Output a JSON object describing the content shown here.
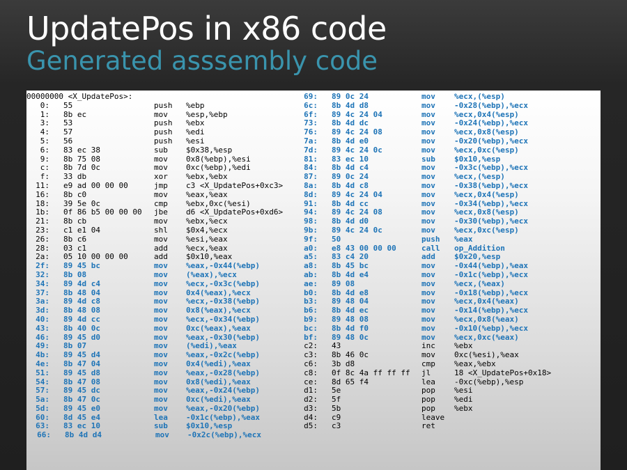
{
  "title": "UpdatePos in x86 code",
  "subtitle": "Generated asssembly code",
  "colors": {
    "highlight": "#1e74b7",
    "subtitle": "#3a94ad"
  },
  "left_header": "00000000 <X_UpdatePos>:",
  "left": [
    {
      "a": "0:",
      "b": "55",
      "c": "push",
      "d": "%ebp",
      "hl": false
    },
    {
      "a": "1:",
      "b": "8b ec",
      "c": "mov",
      "d": "%esp,%ebp",
      "hl": false
    },
    {
      "a": "3:",
      "b": "53",
      "c": "push",
      "d": "%ebx",
      "hl": false
    },
    {
      "a": "4:",
      "b": "57",
      "c": "push",
      "d": "%edi",
      "hl": false
    },
    {
      "a": "5:",
      "b": "56",
      "c": "push",
      "d": "%esi",
      "hl": false
    },
    {
      "a": "6:",
      "b": "83 ec 38",
      "c": "sub",
      "d": "$0x38,%esp",
      "hl": false
    },
    {
      "a": "9:",
      "b": "8b 75 08",
      "c": "mov",
      "d": "0x8(%ebp),%esi",
      "hl": false
    },
    {
      "a": "c:",
      "b": "8b 7d 0c",
      "c": "mov",
      "d": "0xc(%ebp),%edi",
      "hl": false
    },
    {
      "a": "f:",
      "b": "33 db",
      "c": "xor",
      "d": "%ebx,%ebx",
      "hl": false
    },
    {
      "a": "11:",
      "b": "e9 ad 00 00 00",
      "c": "jmp",
      "d": "c3 <X_UpdatePos+0xc3>",
      "hl": false
    },
    {
      "a": "16:",
      "b": "8b c0",
      "c": "mov",
      "d": "%eax,%eax",
      "hl": false
    },
    {
      "a": "18:",
      "b": "39 5e 0c",
      "c": "cmp",
      "d": "%ebx,0xc(%esi)",
      "hl": false
    },
    {
      "a": "1b:",
      "b": "0f 86 b5 00 00 00",
      "c": "jbe",
      "d": "d6 <X_UpdatePos+0xd6>",
      "hl": false
    },
    {
      "a": "21:",
      "b": "8b cb",
      "c": "mov",
      "d": "%ebx,%ecx",
      "hl": false
    },
    {
      "a": "23:",
      "b": "c1 e1 04",
      "c": "shl",
      "d": "$0x4,%ecx",
      "hl": false
    },
    {
      "a": "26:",
      "b": "8b c6",
      "c": "mov",
      "d": "%esi,%eax",
      "hl": false
    },
    {
      "a": "28:",
      "b": "03 c1",
      "c": "add",
      "d": "%ecx,%eax",
      "hl": false
    },
    {
      "a": "2a:",
      "b": "05 10 00 00 00",
      "c": "add",
      "d": "$0x10,%eax",
      "hl": false
    },
    {
      "a": "2f:",
      "b": "89 45 bc",
      "c": "mov",
      "d": "%eax,-0x44(%ebp)",
      "hl": true
    },
    {
      "a": "32:",
      "b": "8b 08",
      "c": "mov",
      "d": "(%eax),%ecx",
      "hl": true
    },
    {
      "a": "34:",
      "b": "89 4d c4",
      "c": "mov",
      "d": "%ecx,-0x3c(%ebp)",
      "hl": true
    },
    {
      "a": "37:",
      "b": "8b 48 04",
      "c": "mov",
      "d": "0x4(%eax),%ecx",
      "hl": true
    },
    {
      "a": "3a:",
      "b": "89 4d c8",
      "c": "mov",
      "d": "%ecx,-0x38(%ebp)",
      "hl": true
    },
    {
      "a": "3d:",
      "b": "8b 48 08",
      "c": "mov",
      "d": "0x8(%eax),%ecx",
      "hl": true
    },
    {
      "a": "40:",
      "b": "89 4d cc",
      "c": "mov",
      "d": "%ecx,-0x34(%ebp)",
      "hl": true
    },
    {
      "a": "43:",
      "b": "8b 40 0c",
      "c": "mov",
      "d": "0xc(%eax),%eax",
      "hl": true
    },
    {
      "a": "46:",
      "b": "89 45 d0",
      "c": "mov",
      "d": "%eax,-0x30(%ebp)",
      "hl": true
    },
    {
      "a": "49:",
      "b": "8b 07",
      "c": "mov",
      "d": "(%edi),%eax",
      "hl": true
    },
    {
      "a": "4b:",
      "b": "89 45 d4",
      "c": "mov",
      "d": "%eax,-0x2c(%ebp)",
      "hl": true
    },
    {
      "a": "4e:",
      "b": "8b 47 04",
      "c": "mov",
      "d": "0x4(%edi),%eax",
      "hl": true
    },
    {
      "a": "51:",
      "b": "89 45 d8",
      "c": "mov",
      "d": "%eax,-0x28(%ebp)",
      "hl": true
    },
    {
      "a": "54:",
      "b": "8b 47 08",
      "c": "mov",
      "d": "0x8(%edi),%eax",
      "hl": true
    },
    {
      "a": "57:",
      "b": "89 45 dc",
      "c": "mov",
      "d": "%eax,-0x24(%ebp)",
      "hl": true
    },
    {
      "a": "5a:",
      "b": "8b 47 0c",
      "c": "mov",
      "d": "0xc(%edi),%eax",
      "hl": true
    },
    {
      "a": "5d:",
      "b": "89 45 e0",
      "c": "mov",
      "d": "%eax,-0x20(%ebp)",
      "hl": true
    },
    {
      "a": "60:",
      "b": "8d 45 e4",
      "c": "lea",
      "d": "-0x1c(%ebp),%eax",
      "hl": true
    },
    {
      "a": "63:",
      "b": "83 ec 10",
      "c": "sub",
      "d": "$0x10,%esp",
      "hl": true
    },
    {
      "a": "66:",
      "b": "8b 4d d4",
      "c": "mov",
      "d": "-0x2c(%ebp),%ecx",
      "hl": true
    }
  ],
  "right": [
    {
      "a": "69:",
      "b": "89 0c 24",
      "c": "mov",
      "d": "%ecx,(%esp)",
      "hl": true
    },
    {
      "a": "6c:",
      "b": "8b 4d d8",
      "c": "mov",
      "d": "-0x28(%ebp),%ecx",
      "hl": true
    },
    {
      "a": "6f:",
      "b": "89 4c 24 04",
      "c": "mov",
      "d": "%ecx,0x4(%esp)",
      "hl": true
    },
    {
      "a": "73:",
      "b": "8b 4d dc",
      "c": "mov",
      "d": "-0x24(%ebp),%ecx",
      "hl": true
    },
    {
      "a": "76:",
      "b": "89 4c 24 08",
      "c": "mov",
      "d": "%ecx,0x8(%esp)",
      "hl": true
    },
    {
      "a": "7a:",
      "b": "8b 4d e0",
      "c": "mov",
      "d": "-0x20(%ebp),%ecx",
      "hl": true
    },
    {
      "a": "7d:",
      "b": "89 4c 24 0c",
      "c": "mov",
      "d": "%ecx,0xc(%esp)",
      "hl": true
    },
    {
      "a": "81:",
      "b": "83 ec 10",
      "c": "sub",
      "d": "$0x10,%esp",
      "hl": true
    },
    {
      "a": "84:",
      "b": "8b 4d c4",
      "c": "mov",
      "d": "-0x3c(%ebp),%ecx",
      "hl": true
    },
    {
      "a": "87:",
      "b": "89 0c 24",
      "c": "mov",
      "d": "%ecx,(%esp)",
      "hl": true
    },
    {
      "a": "8a:",
      "b": "8b 4d c8",
      "c": "mov",
      "d": "-0x38(%ebp),%ecx",
      "hl": true
    },
    {
      "a": "8d:",
      "b": "89 4c 24 04",
      "c": "mov",
      "d": "%ecx,0x4(%esp)",
      "hl": true
    },
    {
      "a": "91:",
      "b": "8b 4d cc",
      "c": "mov",
      "d": "-0x34(%ebp),%ecx",
      "hl": true
    },
    {
      "a": "94:",
      "b": "89 4c 24 08",
      "c": "mov",
      "d": "%ecx,0x8(%esp)",
      "hl": true
    },
    {
      "a": "98:",
      "b": "8b 4d d0",
      "c": "mov",
      "d": "-0x30(%ebp),%ecx",
      "hl": true
    },
    {
      "a": "9b:",
      "b": "89 4c 24 0c",
      "c": "mov",
      "d": "%ecx,0xc(%esp)",
      "hl": true
    },
    {
      "a": "9f:",
      "b": "50",
      "c": "push",
      "d": "%eax",
      "hl": true
    },
    {
      "a": "a0:",
      "b": "e8 43 00 00 00",
      "c": "call",
      "d": "op_Addition",
      "hl": true
    },
    {
      "a": "a5:",
      "b": "83 c4 20",
      "c": "add",
      "d": "$0x20,%esp",
      "hl": true
    },
    {
      "a": "a8:",
      "b": "8b 45 bc",
      "c": "mov",
      "d": "-0x44(%ebp),%eax",
      "hl": true
    },
    {
      "a": "ab:",
      "b": "8b 4d e4",
      "c": "mov",
      "d": "-0x1c(%ebp),%ecx",
      "hl": true
    },
    {
      "a": "ae:",
      "b": "89 08",
      "c": "mov",
      "d": "%ecx,(%eax)",
      "hl": true
    },
    {
      "a": "b0:",
      "b": "8b 4d e8",
      "c": "mov",
      "d": "-0x18(%ebp),%ecx",
      "hl": true
    },
    {
      "a": "b3:",
      "b": "89 48 04",
      "c": "mov",
      "d": "%ecx,0x4(%eax)",
      "hl": true
    },
    {
      "a": "b6:",
      "b": "8b 4d ec",
      "c": "mov",
      "d": "-0x14(%ebp),%ecx",
      "hl": true
    },
    {
      "a": "b9:",
      "b": "89 48 08",
      "c": "mov",
      "d": "%ecx,0x8(%eax)",
      "hl": true
    },
    {
      "a": "bc:",
      "b": "8b 4d f0",
      "c": "mov",
      "d": "-0x10(%ebp),%ecx",
      "hl": true
    },
    {
      "a": "bf:",
      "b": "89 48 0c",
      "c": "mov",
      "d": "%ecx,0xc(%eax)",
      "hl": true
    },
    {
      "a": "c2:",
      "b": "43",
      "c": "inc",
      "d": "%ebx",
      "hl": false
    },
    {
      "a": "c3:",
      "b": "8b 46 0c",
      "c": "mov",
      "d": "0xc(%esi),%eax",
      "hl": false
    },
    {
      "a": "c6:",
      "b": "3b d8",
      "c": "cmp",
      "d": "%eax,%ebx",
      "hl": false
    },
    {
      "a": "c8:",
      "b": "0f 8c 4a ff ff ff",
      "c": "jl",
      "d": "18 <X_UpdatePos+0x18>",
      "hl": false
    },
    {
      "a": "ce:",
      "b": "8d 65 f4",
      "c": "lea",
      "d": "-0xc(%ebp),%esp",
      "hl": false
    },
    {
      "a": "d1:",
      "b": "5e",
      "c": "pop",
      "d": "%esi",
      "hl": false
    },
    {
      "a": "d2:",
      "b": "5f",
      "c": "pop",
      "d": "%edi",
      "hl": false
    },
    {
      "a": "d3:",
      "b": "5b",
      "c": "pop",
      "d": "%ebx",
      "hl": false
    },
    {
      "a": "d4:",
      "b": "c9",
      "c": "leave",
      "d": "",
      "hl": false
    },
    {
      "a": "d5:",
      "b": "c3",
      "c": "ret",
      "d": "",
      "hl": false
    }
  ]
}
